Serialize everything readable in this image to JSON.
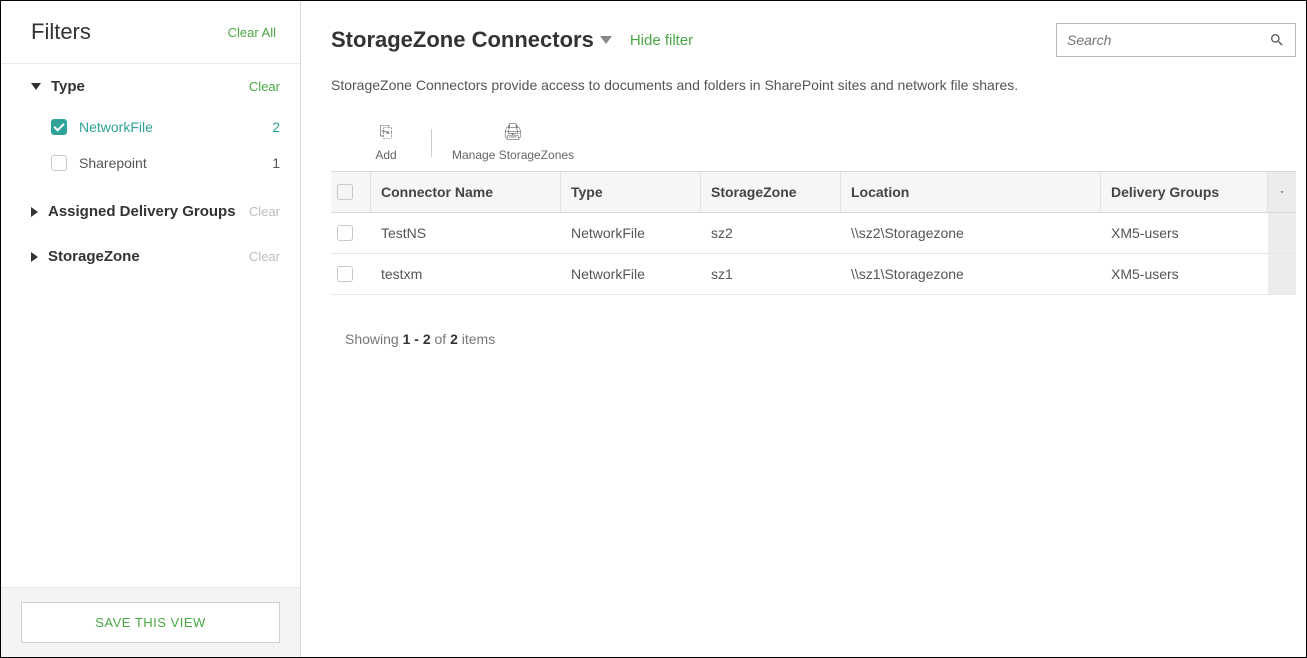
{
  "sidebar": {
    "title": "Filters",
    "clear_all": "Clear All",
    "save_view": "SAVE THIS VIEW",
    "groups": [
      {
        "label": "Type",
        "expanded": true,
        "clear": "Clear",
        "clear_active": true,
        "options": [
          {
            "label": "NetworkFile",
            "count": "2",
            "checked": true
          },
          {
            "label": "Sharepoint",
            "count": "1",
            "checked": false
          }
        ]
      },
      {
        "label": "Assigned Delivery Groups",
        "expanded": false,
        "clear": "Clear",
        "clear_active": false
      },
      {
        "label": "StorageZone",
        "expanded": false,
        "clear": "Clear",
        "clear_active": false
      }
    ]
  },
  "header": {
    "title": "StorageZone Connectors",
    "hide_filter": "Hide filter",
    "search_placeholder": "Search"
  },
  "description": "StorageZone Connectors provide access to documents and folders in SharePoint sites and network file shares.",
  "toolbar": {
    "add": "Add",
    "manage": "Manage StorageZones"
  },
  "table": {
    "columns": {
      "name": "Connector Name",
      "type": "Type",
      "sz": "StorageZone",
      "loc": "Location",
      "dg": "Delivery Groups"
    },
    "rows": [
      {
        "name": "TestNS",
        "type": "NetworkFile",
        "sz": "sz2",
        "loc": "\\\\sz2\\Storagezone",
        "dg": "XM5-users"
      },
      {
        "name": "testxm",
        "type": "NetworkFile",
        "sz": "sz1",
        "loc": "\\\\sz1\\Storagezone",
        "dg": "XM5-users"
      }
    ]
  },
  "pager": {
    "prefix": "Showing ",
    "range": "1 - 2",
    "mid": " of ",
    "total": "2",
    "suffix": " items"
  }
}
